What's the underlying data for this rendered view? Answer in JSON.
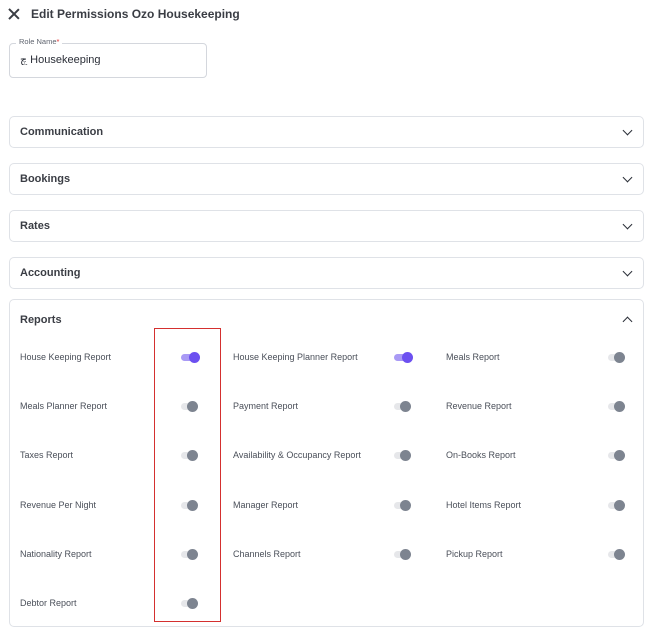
{
  "header": {
    "title": "Edit Permissions Ozo Housekeeping"
  },
  "role_name": {
    "label": "Role Name",
    "required_mark": "*",
    "value": "چ Housekeeping"
  },
  "sections": [
    {
      "title": "Communication",
      "expanded": false
    },
    {
      "title": "Bookings",
      "expanded": false
    },
    {
      "title": "Rates",
      "expanded": false
    },
    {
      "title": "Accounting",
      "expanded": false
    },
    {
      "title": "Reports",
      "expanded": true
    }
  ],
  "reports": [
    {
      "label": "House Keeping Report",
      "enabled": true
    },
    {
      "label": "House Keeping Planner Report",
      "enabled": true
    },
    {
      "label": "Meals Report",
      "enabled": false
    },
    {
      "label": "Meals Planner Report",
      "enabled": false
    },
    {
      "label": "Payment Report",
      "enabled": false
    },
    {
      "label": "Revenue Report",
      "enabled": false
    },
    {
      "label": "Taxes Report",
      "enabled": false
    },
    {
      "label": "Availability & Occupancy Report",
      "enabled": false
    },
    {
      "label": "On-Books Report",
      "enabled": false
    },
    {
      "label": "Revenue Per Night",
      "enabled": false
    },
    {
      "label": "Manager Report",
      "enabled": false
    },
    {
      "label": "Hotel Items Report",
      "enabled": false
    },
    {
      "label": "Nationality Report",
      "enabled": false
    },
    {
      "label": "Channels Report",
      "enabled": false
    },
    {
      "label": "Pickup Report",
      "enabled": false
    },
    {
      "label": "Debtor Report",
      "enabled": false
    }
  ],
  "colors": {
    "toggle_on": "#6c50f0",
    "toggle_off": "#7d8490",
    "highlight_box": "#d4302f"
  }
}
